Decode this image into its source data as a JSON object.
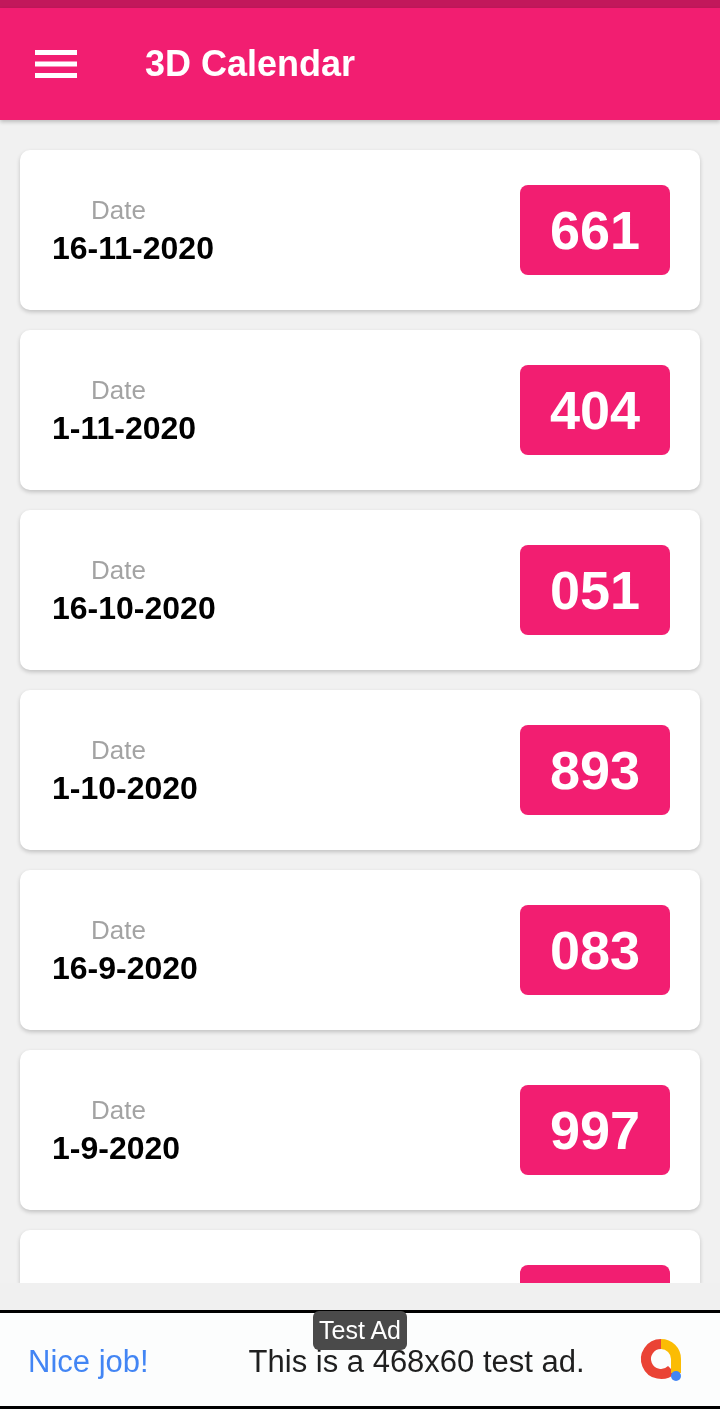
{
  "app_bar": {
    "title": "3D Calendar"
  },
  "results": [
    {
      "label": "Date",
      "date": "16-11-2020",
      "number": "661"
    },
    {
      "label": "Date",
      "date": "1-11-2020",
      "number": "404"
    },
    {
      "label": "Date",
      "date": "16-10-2020",
      "number": "051"
    },
    {
      "label": "Date",
      "date": "1-10-2020",
      "number": "893"
    },
    {
      "label": "Date",
      "date": "16-9-2020",
      "number": "083"
    },
    {
      "label": "Date",
      "date": "1-9-2020",
      "number": "997"
    }
  ],
  "next_row_partly_visible": true,
  "ad_banner": {
    "tag": "Test Ad",
    "headline": "Nice job!",
    "text": "This is a 468x60 test ad."
  }
}
